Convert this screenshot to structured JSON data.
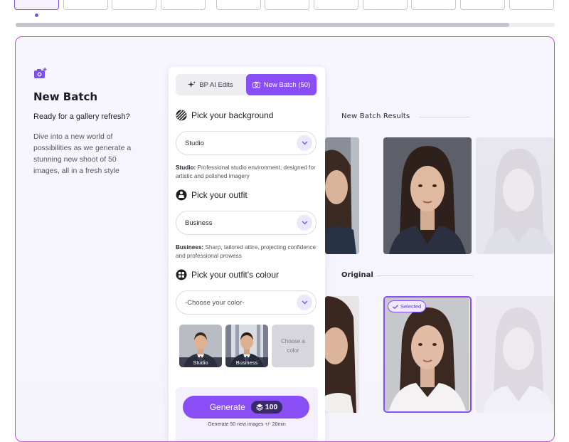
{
  "colors": {
    "accent": "#8a4ef7",
    "card_border": "#c44fe0",
    "credit_bg": "#3a2a6d"
  },
  "thumbnails": {
    "count": 11,
    "active_index": 0
  },
  "intro": {
    "icon": "camera-plus-icon",
    "title": "New Batch",
    "tagline": "Ready for a gallery refresh?",
    "description": "Dive into a new world of possibilities as we generate a stunning new shoot of 50 images, all in a fresh style"
  },
  "tabs": {
    "ai_edits": "BP AI Edits",
    "new_batch": "New Batch (50)"
  },
  "background": {
    "title": "Pick your background",
    "value": "Studio",
    "hint_bold": "Studio:",
    "hint": " Professional studio environment, designed for artistic and polished imagery"
  },
  "outfit": {
    "title": "Pick your outfit",
    "value": "Business",
    "hint_bold": "Business:",
    "hint": " Sharp, tailored attire, projecting confidence and professional prowess"
  },
  "colour": {
    "title": "Pick your outfit's colour",
    "placeholder": "-Choose your color-"
  },
  "presets": [
    {
      "label": "Studio"
    },
    {
      "label": "Business"
    },
    {
      "label": "Choose a color"
    }
  ],
  "generate": {
    "label": "Generate",
    "credits": "100",
    "subtext": "Generate 50 new images +/- 20min"
  },
  "results": {
    "title": "New Batch Results",
    "original_title": "Original",
    "selected_badge": "Selected"
  }
}
